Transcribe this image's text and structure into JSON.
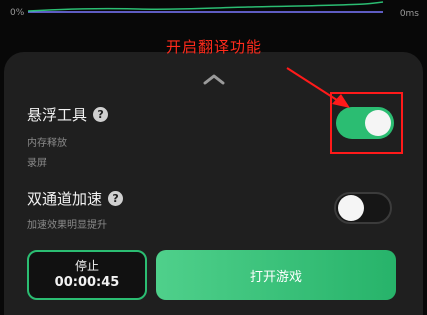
{
  "graph": {
    "left_label": "0%",
    "right_label": "0ms"
  },
  "annotation": {
    "text": "开启翻译功能",
    "color": "#ff2b1c"
  },
  "settings": {
    "floating_tool": {
      "title": "悬浮工具",
      "sub_lines": [
        "内存释放",
        "录屏"
      ],
      "enabled": true
    },
    "dual_channel": {
      "title": "双通道加速",
      "sub_lines": [
        "加速效果明显提升"
      ],
      "enabled": false
    }
  },
  "buttons": {
    "stop_label": "停止",
    "stop_timer": "00:00:45",
    "open_game_label": "打开游戏"
  },
  "colors": {
    "accent_green": "#2bbd72",
    "panel_bg": "#1f1f1f",
    "highlight_red": "#ff1a1a"
  },
  "icons": {
    "help": "help-icon",
    "collapse": "chevron-up-icon"
  }
}
